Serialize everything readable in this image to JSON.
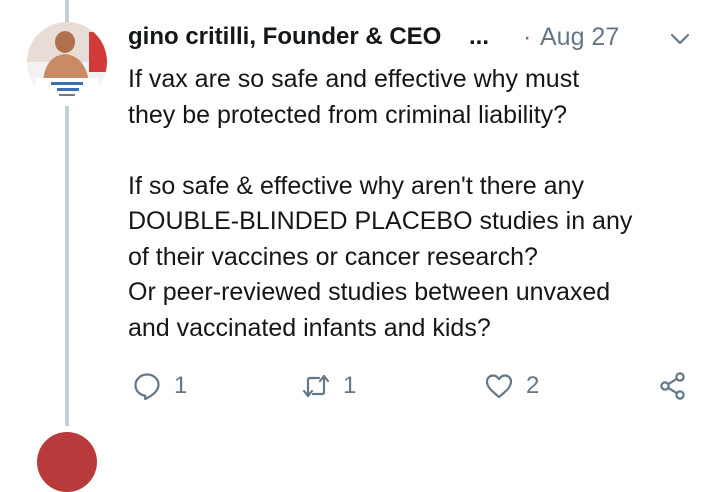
{
  "tweet": {
    "author": "gino critilli, Founder & CEO",
    "truncation": "...",
    "separator": "·",
    "date": "Aug 27",
    "text": "If vax are so safe and effective why must\nthey be protected from criminal liability?\n\nIf so safe & effective why aren't there any\nDOUBLE-BLINDED PLACEBO studies in any\nof their vaccines or cancer research?\nOr peer-reviewed studies between unvaxed\nand vaccinated infants and kids?",
    "reply_count": "1",
    "retweet_count": "1",
    "like_count": "2",
    "icons": {
      "menu": "chevron-down-icon",
      "reply": "reply-icon",
      "retweet": "retweet-icon",
      "like": "heart-icon",
      "share": "share-icon"
    }
  },
  "colors": {
    "text": "#14171a",
    "secondary": "#657786",
    "thread_line": "#c4cfd6",
    "background": "#ffffff"
  }
}
